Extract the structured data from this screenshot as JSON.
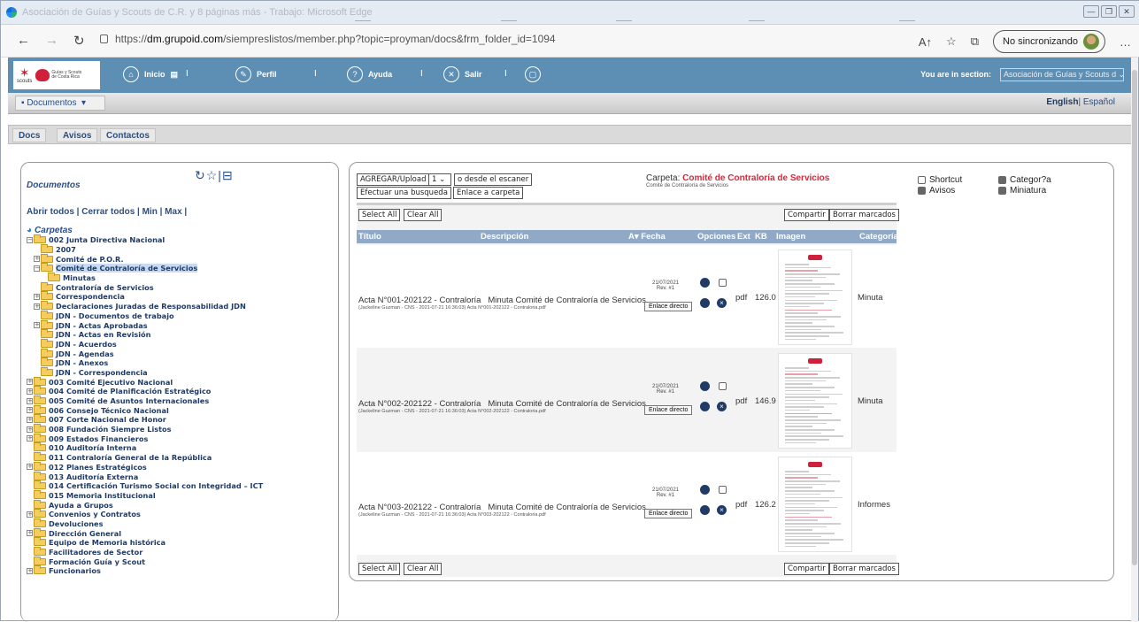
{
  "browser": {
    "window_title": "Asociación de Guías y Scouts de C.R. y 8 páginas más - Trabajo: Microsoft Edge",
    "url_prefix": "https://",
    "url_host": "dm.grupoid.com",
    "url_path": "/siempreslistos/member.php?topic=proyman/docs&frm_folder_id=1094",
    "sync_label": "No sincronizando"
  },
  "header": {
    "logo_text": "scouts",
    "brand_text": "Guías y Scouts de Costa Rica",
    "nav": [
      "Inicio",
      "Perfil",
      "Ayuda",
      "Salir"
    ],
    "section_label": "You are in section:",
    "section_value": "Asociación de Guías y Scouts d"
  },
  "submenu": {
    "documents": "Documentos",
    "lang_en": "English",
    "lang_es": "Español"
  },
  "tabs": [
    "Docs",
    "Avisos",
    "Contactos"
  ],
  "left": {
    "title": "Documentos",
    "links": "Abrir todos | Cerrar todos | Min | Max |",
    "root": "Carpetas",
    "tree": [
      {
        "label": "002 Junta Directiva Nacional",
        "lvl": 0,
        "exp": "-"
      },
      {
        "label": "2007",
        "lvl": 1,
        "exp": ""
      },
      {
        "label": "Comité de P.O.R.",
        "lvl": 1,
        "exp": "+"
      },
      {
        "label": "Comité de Contraloría de Servicios",
        "lvl": 1,
        "exp": "-",
        "sel": true
      },
      {
        "label": "Minutas",
        "lvl": 2,
        "exp": ""
      },
      {
        "label": "Contraloría de Servicios",
        "lvl": 1,
        "exp": ""
      },
      {
        "label": "Correspondencia",
        "lvl": 1,
        "exp": "+"
      },
      {
        "label": "Declaraciones Juradas de Responsabilidad JDN",
        "lvl": 1,
        "exp": "+"
      },
      {
        "label": "JDN - Documentos de trabajo",
        "lvl": 1,
        "exp": ""
      },
      {
        "label": "JDN - Actas Aprobadas",
        "lvl": 1,
        "exp": "+"
      },
      {
        "label": "JDN - Actas en Revisión",
        "lvl": 1,
        "exp": ""
      },
      {
        "label": "JDN - Acuerdos",
        "lvl": 1,
        "exp": ""
      },
      {
        "label": "JDN - Agendas",
        "lvl": 1,
        "exp": ""
      },
      {
        "label": "JDN - Anexos",
        "lvl": 1,
        "exp": ""
      },
      {
        "label": "JDN - Correspondencia",
        "lvl": 1,
        "exp": ""
      },
      {
        "label": "003 Comité Ejecutivo Nacional",
        "lvl": 0,
        "exp": "+"
      },
      {
        "label": "004 Comité de Planificación Estratégico",
        "lvl": 0,
        "exp": "+"
      },
      {
        "label": "005 Comité de Asuntos Internacionales",
        "lvl": 0,
        "exp": "+"
      },
      {
        "label": "006 Consejo Técnico Nacional",
        "lvl": 0,
        "exp": "+"
      },
      {
        "label": "007 Corte Nacional de Honor",
        "lvl": 0,
        "exp": "+"
      },
      {
        "label": "008 Fundación Siempre Listos",
        "lvl": 0,
        "exp": "+"
      },
      {
        "label": "009 Estados Financieros",
        "lvl": 0,
        "exp": "+"
      },
      {
        "label": "010 Auditoría Interna",
        "lvl": 0,
        "exp": ""
      },
      {
        "label": "011 Contraloría General de la República",
        "lvl": 0,
        "exp": ""
      },
      {
        "label": "012 Planes Estratégicos",
        "lvl": 0,
        "exp": "+"
      },
      {
        "label": "013 Auditoría Externa",
        "lvl": 0,
        "exp": ""
      },
      {
        "label": "014 Certificación Turismo Social con Integridad – ICT",
        "lvl": 0,
        "exp": ""
      },
      {
        "label": "015 Memoria Institucional",
        "lvl": 0,
        "exp": ""
      },
      {
        "label": "Ayuda a Grupos",
        "lvl": 0,
        "exp": ""
      },
      {
        "label": "Convenios y Contratos",
        "lvl": 0,
        "exp": "+"
      },
      {
        "label": "Devoluciones",
        "lvl": 0,
        "exp": ""
      },
      {
        "label": "Dirección General",
        "lvl": 0,
        "exp": "+"
      },
      {
        "label": "Equipo de Memoria histórica",
        "lvl": 0,
        "exp": ""
      },
      {
        "label": "Facilitadores de Sector",
        "lvl": 0,
        "exp": ""
      },
      {
        "label": "Formación Guía y Scout",
        "lvl": 0,
        "exp": ""
      },
      {
        "label": "Funcionarios",
        "lvl": 0,
        "exp": "+"
      }
    ]
  },
  "right": {
    "upload_btn": "AGREGAR/Upload",
    "upload_count": "1",
    "scanner_btn": "o desde el escaner",
    "search_btn": "Efectuar una busqueda",
    "link_btn": "Enlace a carpeta",
    "carpeta_label": "Carpeta:",
    "carpeta_name": "Comité de Contraloría de Servicios",
    "carpeta_sub": "Comité de Contraloría de Servicios",
    "opt_shortcut": "Shortcut",
    "opt_avisos": "Avisos",
    "opt_categoria": "Categor?a",
    "opt_miniatura": "Miniatura",
    "select_all": "Select All",
    "clear_all": "Clear All",
    "share": "Compartir",
    "delete_marked": "Borrar marcados",
    "columns": {
      "titulo": "Título",
      "descripcion": "Descripción",
      "fecha": "A▾ Fecha",
      "opciones": "Opciones",
      "ext": "Ext",
      "kb": "KB",
      "imagen": "Imagen",
      "categoria": "Categoría"
    },
    "rows": [
      {
        "title": "Acta N°001-202122 - Contraloría",
        "desc": "Minuta Comité de Contraloría de Servicios",
        "sub": "(Jackeline Guzman - CNS - 2021-07-21 16:36:03)   Acta N°001-202122 - Contraloria.pdf",
        "date": "21/07/2021",
        "rev": "Rev. #1",
        "link": "Enlace directo",
        "ext": "pdf",
        "kb": "126.0",
        "cat": "Minuta"
      },
      {
        "title": "Acta N°002-202122 - Contraloría",
        "desc": "Minuta Comité de Contraloría de Servicios",
        "sub": "(Jackeline Guzman - CNS - 2021-07-21 16:36:03)   Acta N°002-202122 - Contraloria.pdf",
        "date": "21/07/2021",
        "rev": "Rev. #1",
        "link": "Enlace directo",
        "ext": "pdf",
        "kb": "146.9",
        "cat": "Minuta"
      },
      {
        "title": "Acta N°003-202122 - Contraloría",
        "desc": "Minuta Comité de Contraloría de Servicios",
        "sub": "(Jackeline Guzman - CNS - 2021-07-21 16:36:03)   Acta N°003-202122 - Contraloria.pdf",
        "date": "21/07/2021",
        "rev": "Rev. #1",
        "link": "Enlace directo",
        "ext": "pdf",
        "kb": "126.2",
        "cat": "Informes"
      }
    ]
  }
}
